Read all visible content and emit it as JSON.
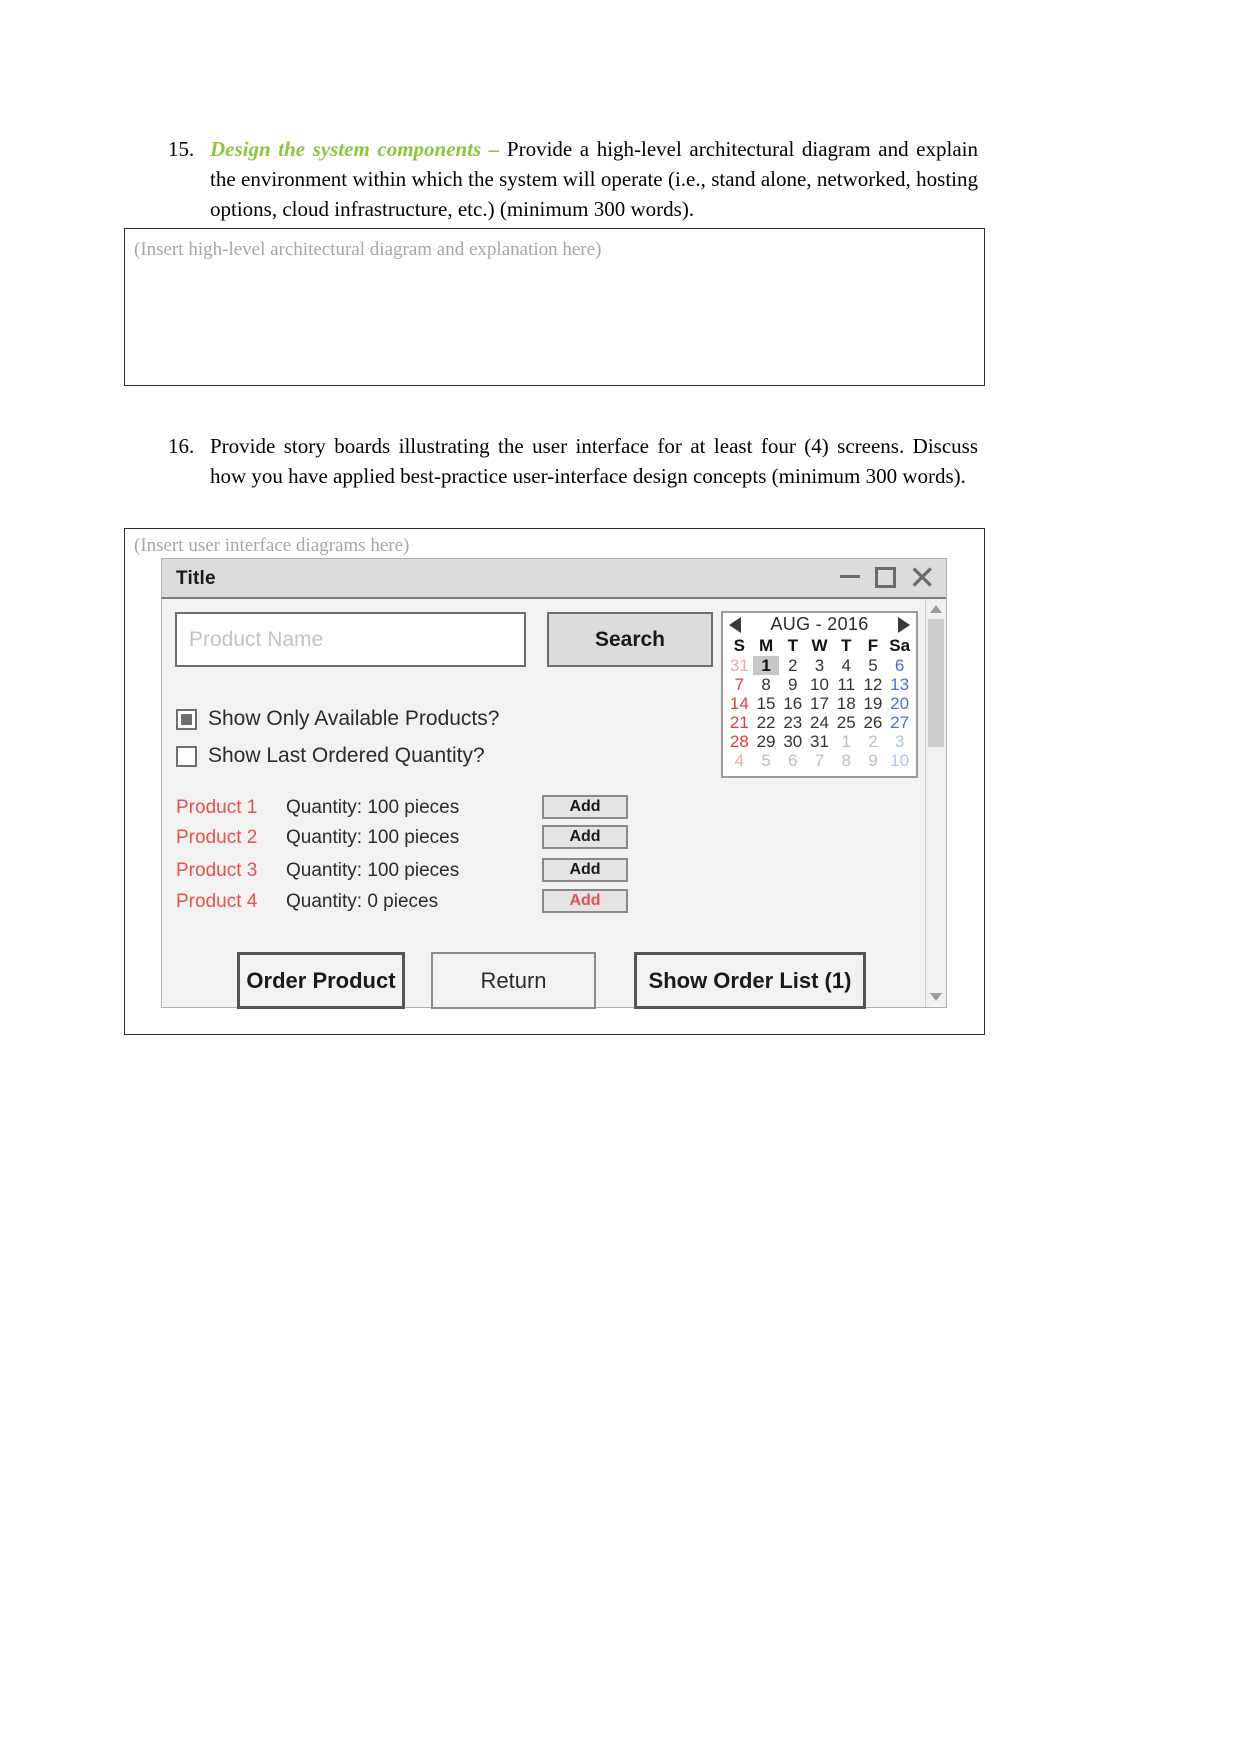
{
  "document": {
    "items": [
      {
        "number": "15.",
        "emphasis": "Design the system components – ",
        "text": "Provide a high-level architectural diagram and explain the environment within which the system will operate (i.e., stand alone, networked, hosting options, cloud infrastructure, etc.) (minimum 300 words)."
      },
      {
        "number": "16.",
        "emphasis": "",
        "text": "Provide story boards illustrating the user interface for at least four (4) screens. Discuss how you have applied best-practice user-interface design concepts (minimum 300 words)."
      }
    ],
    "insert_boxes": [
      {
        "placeholder": "(Insert high-level architectural diagram and explanation here)"
      },
      {
        "placeholder": "(Insert user interface diagrams here)"
      }
    ]
  },
  "mockup": {
    "window_title": "Title",
    "window_controls": {
      "minimize": "minimize-icon",
      "maximize": "maximize-icon",
      "close": "✕"
    },
    "search": {
      "input_placeholder": "Product Name",
      "input_value": "",
      "button_label": "Search"
    },
    "calendar": {
      "title": "AUG - 2016",
      "prev_label": "◀",
      "next_label": "▶",
      "day_headers": [
        "S",
        "M",
        "T",
        "W",
        "T",
        "F",
        "Sa"
      ],
      "selected_day": 1,
      "weeks": [
        [
          {
            "n": "31",
            "kind": "muted-red"
          },
          {
            "n": "1",
            "kind": "sel"
          },
          {
            "n": "2",
            "kind": "day"
          },
          {
            "n": "3",
            "kind": "day"
          },
          {
            "n": "4",
            "kind": "day"
          },
          {
            "n": "5",
            "kind": "day"
          },
          {
            "n": "6",
            "kind": "sat"
          }
        ],
        [
          {
            "n": "7",
            "kind": "wknd"
          },
          {
            "n": "8",
            "kind": "day"
          },
          {
            "n": "9",
            "kind": "day"
          },
          {
            "n": "10",
            "kind": "day"
          },
          {
            "n": "11",
            "kind": "day"
          },
          {
            "n": "12",
            "kind": "day"
          },
          {
            "n": "13",
            "kind": "sat"
          }
        ],
        [
          {
            "n": "14",
            "kind": "wknd"
          },
          {
            "n": "15",
            "kind": "day"
          },
          {
            "n": "16",
            "kind": "day"
          },
          {
            "n": "17",
            "kind": "day"
          },
          {
            "n": "18",
            "kind": "day"
          },
          {
            "n": "19",
            "kind": "day"
          },
          {
            "n": "20",
            "kind": "sat"
          }
        ],
        [
          {
            "n": "21",
            "kind": "wknd"
          },
          {
            "n": "22",
            "kind": "day"
          },
          {
            "n": "23",
            "kind": "day"
          },
          {
            "n": "24",
            "kind": "day"
          },
          {
            "n": "25",
            "kind": "day"
          },
          {
            "n": "26",
            "kind": "day"
          },
          {
            "n": "27",
            "kind": "sat"
          }
        ],
        [
          {
            "n": "28",
            "kind": "wknd"
          },
          {
            "n": "29",
            "kind": "day"
          },
          {
            "n": "30",
            "kind": "day"
          },
          {
            "n": "31",
            "kind": "day"
          },
          {
            "n": "1",
            "kind": "muted"
          },
          {
            "n": "2",
            "kind": "muted"
          },
          {
            "n": "3",
            "kind": "muted-blue"
          }
        ],
        [
          {
            "n": "4",
            "kind": "muted-red"
          },
          {
            "n": "5",
            "kind": "muted"
          },
          {
            "n": "6",
            "kind": "muted"
          },
          {
            "n": "7",
            "kind": "muted"
          },
          {
            "n": "8",
            "kind": "muted"
          },
          {
            "n": "9",
            "kind": "muted"
          },
          {
            "n": "10",
            "kind": "muted-blue"
          }
        ]
      ]
    },
    "options": [
      {
        "label": "Show Only Available Products?",
        "checked": true
      },
      {
        "label": "Show Last Ordered Quantity?",
        "checked": false
      }
    ],
    "products": [
      {
        "name": "Product 1",
        "quantity": "Quantity: 100 pieces",
        "add_label": "Add",
        "available": true
      },
      {
        "name": "Product 2",
        "quantity": "Quantity: 100 pieces",
        "add_label": "Add",
        "available": true
      },
      {
        "name": "Product 3",
        "quantity": "Quantity: 100 pieces",
        "add_label": "Add",
        "available": true
      },
      {
        "name": "Product 4",
        "quantity": "Quantity: 0 pieces",
        "add_label": "Add",
        "available": false
      }
    ],
    "footer": {
      "order_label": "Order Product",
      "return_label": "Return",
      "order_list_label": "Show Order List (1)"
    }
  },
  "colors": {
    "emphasis_green": "#8cc63e",
    "product_red": "#e8504d",
    "calendar_sunday": "#e23b3b",
    "calendar_saturday": "#4a6fd4",
    "placeholder_gray": "#a6a6a6"
  }
}
